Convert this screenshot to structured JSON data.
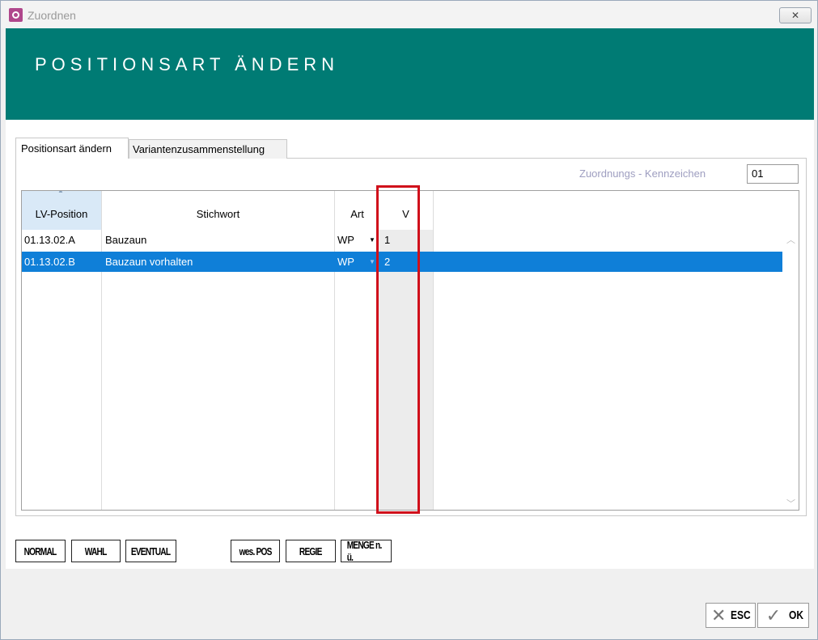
{
  "window": {
    "title": "Zuordnen",
    "close_glyph": "✕"
  },
  "header": {
    "title": "POSITIONSART ÄNDERN"
  },
  "tabs": [
    {
      "label": "Positionsart ändern",
      "active": true
    },
    {
      "label": "Variantenzusammenstellung",
      "active": false
    }
  ],
  "kennzeichen": {
    "label": "Zuordnungs - Kennzeichen",
    "value": "01"
  },
  "grid": {
    "columns": [
      "LV-Position",
      "Stichwort",
      "Art",
      "V"
    ],
    "sort_indicator": "▲",
    "rows": [
      {
        "position": "01.13.02.A",
        "stichwort": "Bauzaun",
        "art": "WP",
        "v": "1",
        "selected": false
      },
      {
        "position": "01.13.02.B",
        "stichwort": "Bauzaun vorhalten",
        "art": "WP",
        "v": "2",
        "selected": true
      }
    ]
  },
  "position_type_buttons": {
    "normal": "NORMAL",
    "wahl": "WAHL",
    "eventual": "EVENTUAL",
    "wes_pos": "wes. POS",
    "regie": "REGIE",
    "menge": "MENGE n. ü."
  },
  "dialog_buttons": {
    "esc_label": "ESC",
    "esc_glyph": "✕",
    "ok_label": "OK",
    "ok_glyph": "✓"
  },
  "colors": {
    "header_bg": "#007b74",
    "selection": "#0f7fd8",
    "highlight_border": "#d0101b"
  }
}
